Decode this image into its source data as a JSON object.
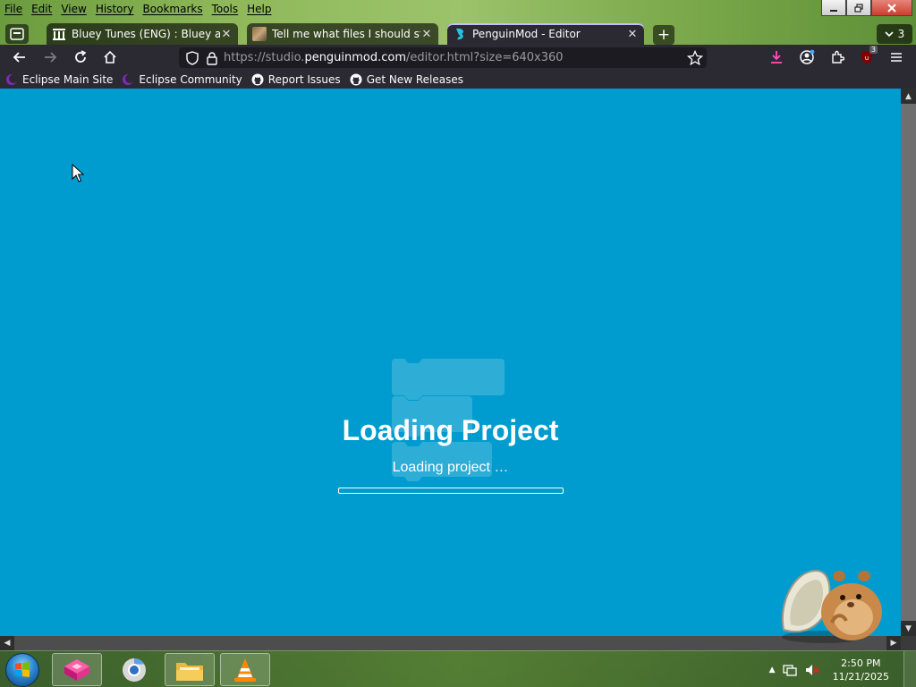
{
  "menubar": {
    "items": [
      "File",
      "Edit",
      "View",
      "History",
      "Bookmarks",
      "Tools",
      "Help"
    ]
  },
  "tabs": [
    {
      "label": "Bluey Tunes (ENG) : Bluey and A",
      "icon": "archive-icon"
    },
    {
      "label": "Tell me what files I should steal",
      "icon": "thumbnail-icon"
    },
    {
      "label": "PenguinMod - Editor",
      "icon": "penguinmod-icon",
      "active": true
    }
  ],
  "tab_list_count": "3",
  "url": {
    "prefix": "https://studio.",
    "host": "penguinmod.com",
    "path": "/editor.html?size=640x360"
  },
  "extension_badge": "3",
  "bookmarks": [
    {
      "label": "Eclipse Main Site",
      "icon": "eclipse-icon"
    },
    {
      "label": "Eclipse Community",
      "icon": "eclipse-icon"
    },
    {
      "label": "Report Issues",
      "icon": "github-icon"
    },
    {
      "label": "Get New Releases",
      "icon": "github-icon"
    }
  ],
  "page": {
    "background": "#009ccf",
    "title": "Loading Project",
    "status": "Loading project …",
    "progress": 0
  },
  "taskbar": {
    "clock_time": "2:50 PM",
    "clock_date": "11/21/2025",
    "apps": [
      "firefox-icon",
      "chrome-icon",
      "explorer-icon",
      "vlc-icon"
    ]
  }
}
